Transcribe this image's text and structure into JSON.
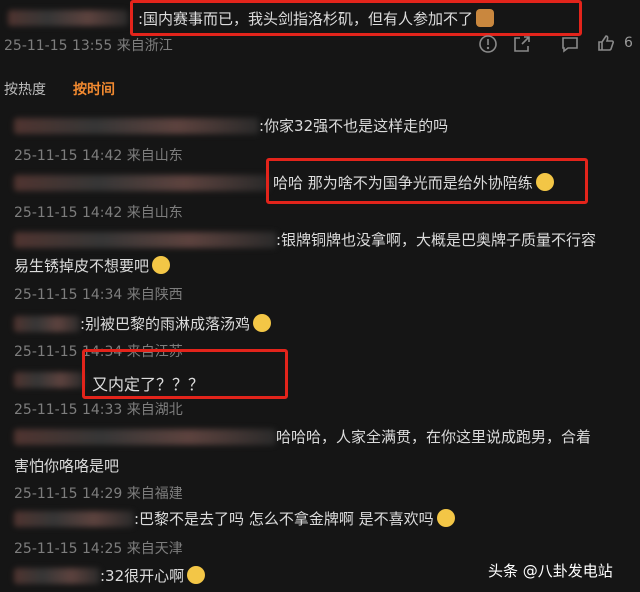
{
  "top_comment": {
    "text": ":国内赛事而已，我头剑指洛杉矶，但有人参加不了",
    "meta": "25-11-15 13:55 来自浙江",
    "like_count": "6"
  },
  "tabs": [
    "按热度",
    "按时间"
  ],
  "replies": [
    {
      "text": ":你家32强不也是这样走的吗",
      "meta": "25-11-15 14:42 来自山东"
    },
    {
      "text": "哈哈 那为啥不为国争光而是给外协陪练",
      "meta": "25-11-15 14:42 来自山东"
    },
    {
      "text": ":银牌铜牌也没拿啊，大概是巴奥牌子质量不行容",
      "text2": "易生锈掉皮不想要吧",
      "meta": "25-11-15 14:34 来自陕西"
    },
    {
      "text": ":别被巴黎的雨淋成落汤鸡",
      "meta": "25-11-15 14:34 来自江苏"
    },
    {
      "text": "又内定了？？？",
      "meta": "25-11-15 14:33 来自湖北"
    },
    {
      "text": "哈哈哈，人家全满贯，在你这里说成跑男，合着",
      "text2": "害怕你咯咯是吧",
      "meta": "25-11-15 14:29 来自福建"
    },
    {
      "text": ":巴黎不是去了吗 怎么不拿金牌啊 是不喜欢吗",
      "meta": "25-11-15 14:25 来自天津"
    },
    {
      "text": ":32很开心啊",
      "meta": ""
    }
  ],
  "watermark": "头条 @八卦发电站",
  "colors": {
    "highlight": "#e3241b",
    "active_tab": "#f28a30",
    "background": "#151515"
  },
  "icons": [
    "dislike-icon",
    "share-icon",
    "comment-icon",
    "thumbs-up-icon"
  ]
}
